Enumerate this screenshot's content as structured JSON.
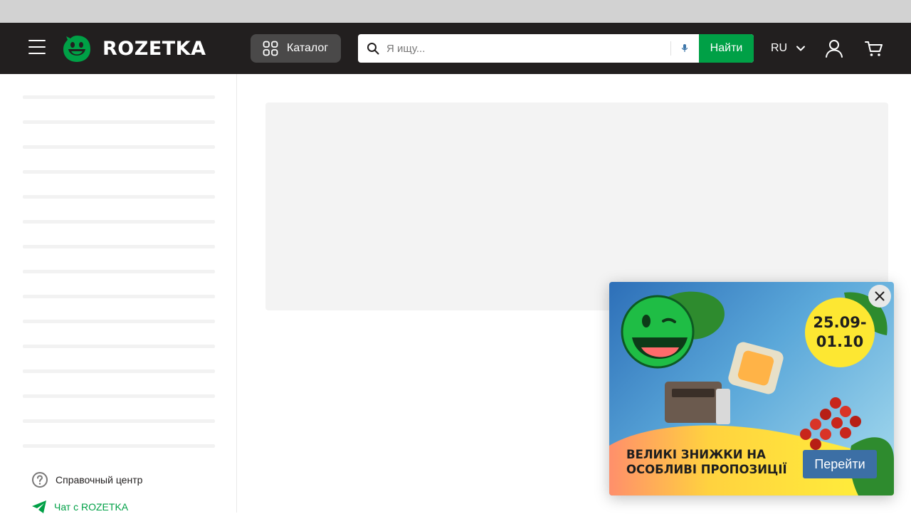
{
  "header": {
    "logo_text": "ROZETKA",
    "catalog_label": "Каталог",
    "search_placeholder": "Я ищу...",
    "search_button": "Найти",
    "language": "RU"
  },
  "sidebar": {
    "help_label": "Справочный центр",
    "chat_label": "Чат с ROZETKA"
  },
  "promo": {
    "date_line1": "25.09-",
    "date_line2": "01.10",
    "headline_line1": "ВЕЛИКІ ЗНИЖКИ НА",
    "headline_line2": "ОСОБЛИВІ ПРОПОЗИЦІЇ",
    "button_label": "Перейти"
  },
  "colors": {
    "header_bg": "#221f1f",
    "brand_green": "#00a046",
    "catalog_bg": "#4a4949",
    "promo_button": "#3c6fa5",
    "promo_date_bg": "#fde732"
  },
  "icons": {
    "menu": "hamburger-menu-icon",
    "catalog": "grid-icon",
    "search": "search-icon",
    "mic": "microphone-icon",
    "lang_chevron": "chevron-down-icon",
    "user": "user-icon",
    "cart": "cart-icon",
    "help": "question-circle-icon",
    "chat": "send-icon",
    "close": "close-icon"
  }
}
